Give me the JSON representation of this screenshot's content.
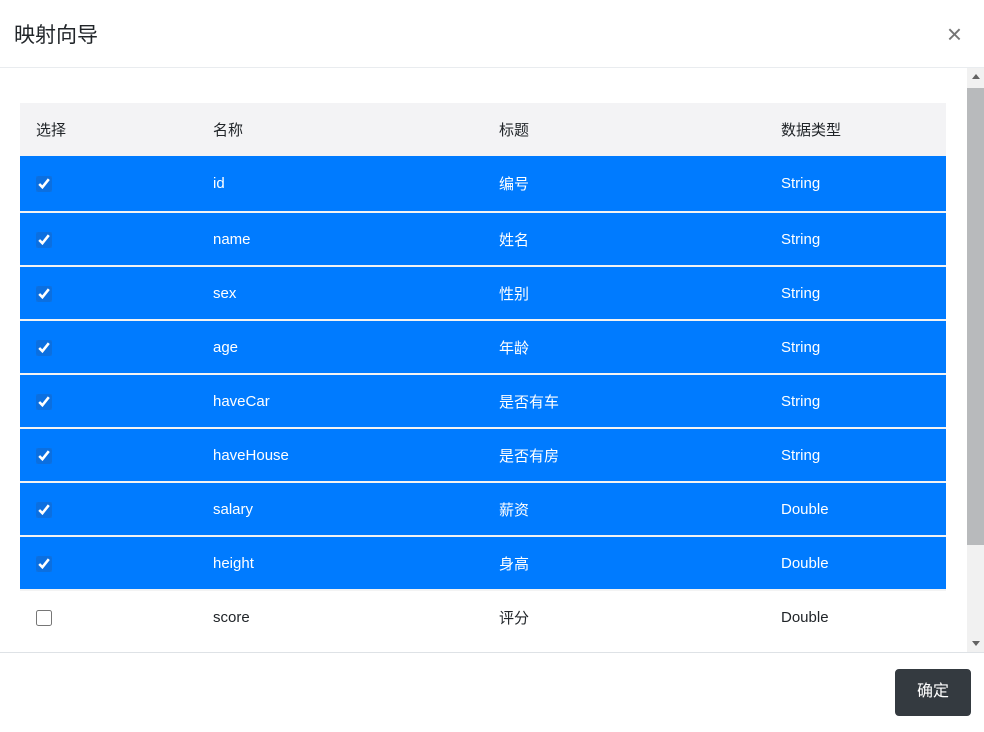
{
  "modal": {
    "title": "映射向导",
    "close_glyph": "×",
    "confirm_label": "确定"
  },
  "table": {
    "columns": [
      "选择",
      "名称",
      "标题",
      "数据类型"
    ],
    "rows": [
      {
        "selected": true,
        "name": "id",
        "title": "编号",
        "type": "String"
      },
      {
        "selected": true,
        "name": "name",
        "title": "姓名",
        "type": "String"
      },
      {
        "selected": true,
        "name": "sex",
        "title": "性别",
        "type": "String"
      },
      {
        "selected": true,
        "name": "age",
        "title": "年龄",
        "type": "String"
      },
      {
        "selected": true,
        "name": "haveCar",
        "title": "是否有车",
        "type": "String"
      },
      {
        "selected": true,
        "name": "haveHouse",
        "title": "是否有房",
        "type": "String"
      },
      {
        "selected": true,
        "name": "salary",
        "title": "薪资",
        "type": "Double"
      },
      {
        "selected": true,
        "name": "height",
        "title": "身高",
        "type": "Double"
      },
      {
        "selected": false,
        "name": "score",
        "title": "评分",
        "type": "Double"
      }
    ]
  },
  "colors": {
    "selected_row_bg": "#007bff",
    "selected_row_text": "#ffffff",
    "header_bg": "#f3f3f5",
    "confirm_button_bg": "#343a40",
    "confirm_button_text": "#ffffff"
  }
}
